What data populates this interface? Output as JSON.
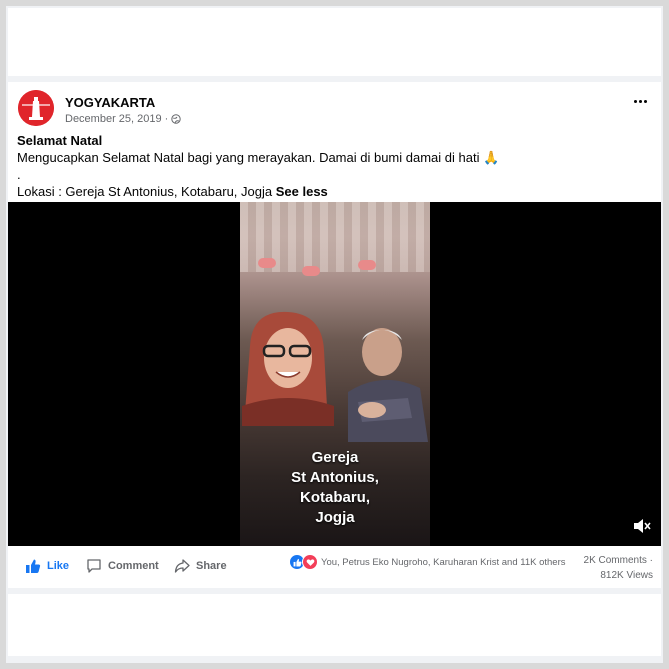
{
  "post": {
    "page_name": "YOGYAKARTA",
    "date": "December 25, 2019",
    "separator": "·",
    "title": "Selamat Natal",
    "body_line1": "Mengucapkan Selamat Natal bagi yang merayakan. Damai di bumi damai di hati 🙏",
    "body_line2": ".",
    "body_line3": "Lokasi : Gereja St Antonius, Kotabaru, Jogja",
    "see_less": "See less"
  },
  "video": {
    "caption_lines": [
      "Gereja",
      "St Antonius,",
      "Kotabaru,",
      "Jogja"
    ],
    "volume_icon": "volume-muted-icon"
  },
  "actions": {
    "like_label": "Like",
    "comment_label": "Comment",
    "share_label": "Share"
  },
  "stats": {
    "reactions_text": "You, Petrus Eko Nugroho, Karuharan Krist and 11K others",
    "comments": "2K Comments",
    "dot": "·",
    "views": "812K Views"
  },
  "colors": {
    "accent": "#1877f2",
    "love": "#f33e58",
    "avatar_bg": "#e0252b"
  }
}
